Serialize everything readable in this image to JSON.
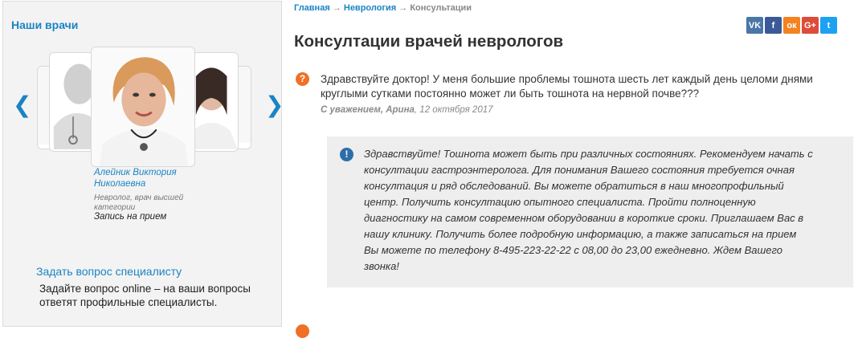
{
  "sidebar": {
    "title": "Наши врачи",
    "prev_arrow": "❮",
    "next_arrow": "❯",
    "doctor": {
      "name": "Алейник Виктория Николаевна",
      "position": "Невролог, врач высшей категории",
      "appointment": "Запись на прием"
    },
    "ask_link": "Задать вопрос специалисту",
    "ask_description": "Задайте вопрос online – на ваши вопросы ответят профильные специалисты."
  },
  "breadcrumb": {
    "home": "Главная",
    "section": "Неврология",
    "current": "Консультации",
    "separator": "→"
  },
  "page_title": "Консултации врачей неврологов",
  "social": [
    {
      "name": "vk",
      "label": "VK",
      "color": "#4a76a8"
    },
    {
      "name": "facebook",
      "label": "f",
      "color": "#3b5998"
    },
    {
      "name": "odnoklassniki",
      "label": "ок",
      "color": "#f58220"
    },
    {
      "name": "google-plus",
      "label": "G+",
      "color": "#dd4b39"
    },
    {
      "name": "twitter",
      "label": "t",
      "color": "#1da1f2"
    }
  ],
  "question": {
    "icon": "?",
    "text": "Здравствуйте доктор! У меня большие проблемы тошнота шесть лет каждый день целоми днями круглыми сутками постоянно может ли быть тошнота на нервной почве???",
    "signature_prefix": "С уважением, Арина",
    "date": ", 12 октября 2017"
  },
  "answer": {
    "icon": "!",
    "text": "Здравствуйте! Тошнота может быть при различных состояниях. Рекомендуем начать с консултации гастроэнтеролога. Для понимания Вашего состояния требуется очная консултация и ряд обследований. Вы можете обратиться в наш многопрофильный центр. Получить консултацию опытного специалиста. Пройти полноценную диагностику на самом современном оборудовании в короткие сроки. Приглашаем Вас в нашу клинику. Получить более подробную информацию, а также записаться на прием Вы можете по телефону 8-495-223-22-22 с 08,00 до 23,00 ежедневно. Ждем Вашего звонка!"
  }
}
